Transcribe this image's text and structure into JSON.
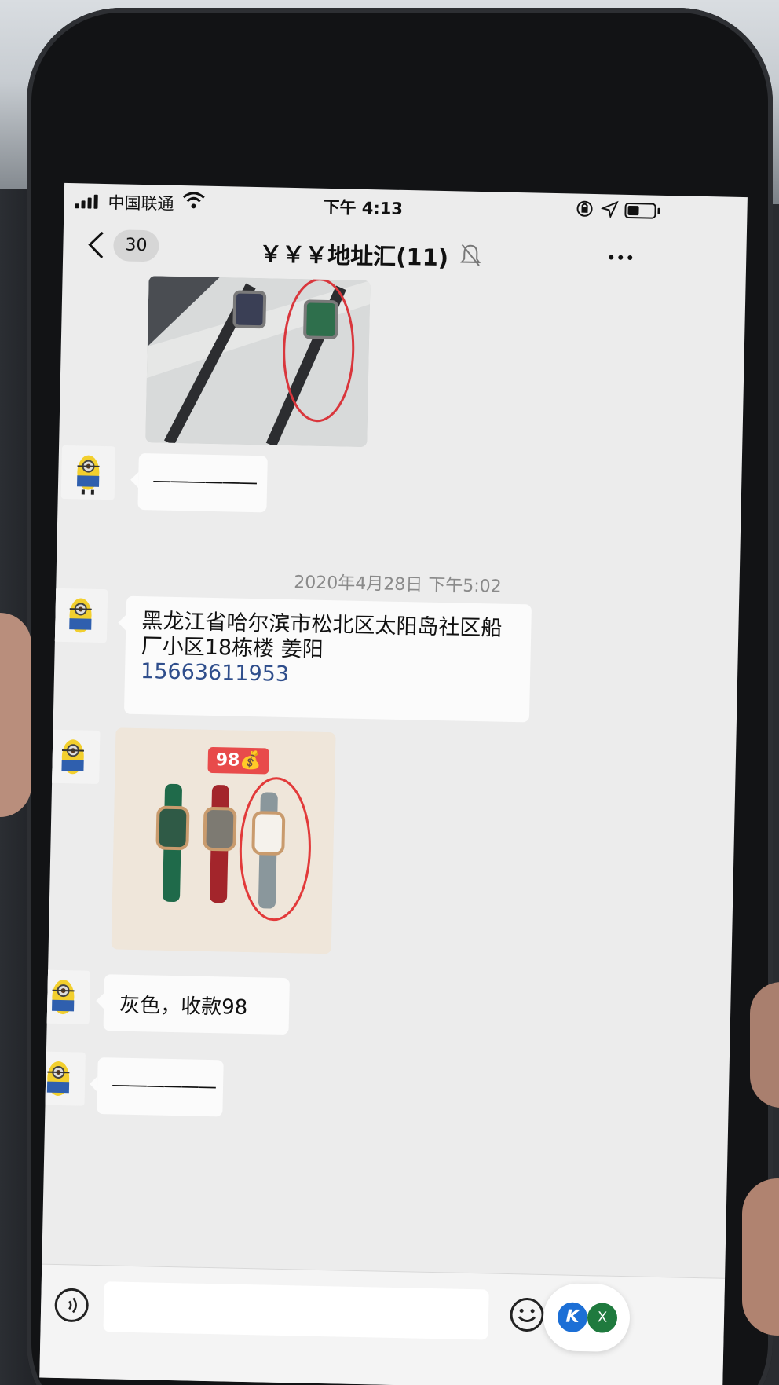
{
  "status_bar": {
    "carrier": "中国联通",
    "time": "下午 4:13"
  },
  "nav": {
    "back_count": "30",
    "title": "￥￥￥地址汇(11)"
  },
  "messages": {
    "timestamp": "2020年4月28日 下午5:02",
    "dash_1": "——————",
    "address_line": "黑龙江省哈尔滨市松北区太阳岛社区船厂小区18栋楼  姜阳",
    "phone_number": "15663611953",
    "price_tag": "98💰",
    "reply_text": "灰色，收款98",
    "dash_2": "——————"
  },
  "input_bar": {
    "fab_k": "K",
    "fab_x": "X"
  },
  "icons": {
    "back": "chevron-left-icon",
    "mute": "bell-slash-icon",
    "more": "ellipsis-icon",
    "voice": "voice-icon",
    "emoji": "smile-icon"
  }
}
